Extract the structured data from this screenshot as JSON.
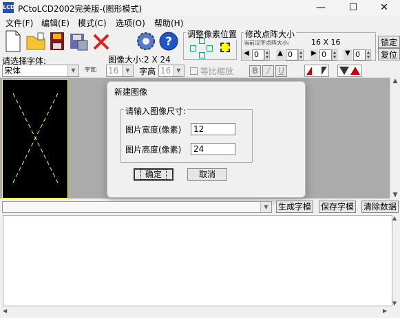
{
  "window": {
    "title": "PCtoLCD2002完美版-(图形模式)",
    "minimize": "—",
    "maximize": "☐",
    "close": "✕"
  },
  "menu": [
    {
      "label": "文件(F)"
    },
    {
      "label": "编辑(E)"
    },
    {
      "label": "模式(C)"
    },
    {
      "label": "选项(O)"
    },
    {
      "label": "帮助(H)"
    }
  ],
  "toolbar": {
    "new_icon": "new-file-icon",
    "open_icon": "open-folder-icon",
    "save_icon": "save-icon",
    "export_icon": "save-as-icon",
    "delete_icon": "delete-x-icon",
    "settings_icon": "gear-icon",
    "help_icon": "help-icon"
  },
  "pixel_adjust": {
    "label": "调整像素位置"
  },
  "dot_size": {
    "label": "修改点阵大小",
    "current_label": "当前汉字点阵大小:",
    "current_value": "16 X 16",
    "spin_values": [
      "0",
      "0",
      "0",
      "0"
    ]
  },
  "side_buttons": {
    "lock": "锁定",
    "reset": "复位"
  },
  "font": {
    "prompt": "请选择字体:",
    "selected": "宋体",
    "size_label": "字宽:",
    "size_value": "16"
  },
  "image": {
    "size_label": "图像大小:",
    "size_value": "2 X 24",
    "height_label": "字高",
    "height_value": "16",
    "proportional": "等比缩放"
  },
  "style_buttons": [
    "B",
    "/",
    "U"
  ],
  "dialog": {
    "title": "新建图像",
    "group": "请输入图像尺寸:",
    "width_label": "图片宽度(像素)",
    "width_value": "12",
    "height_label": "图片高度(像素)",
    "height_value": "24",
    "ok": "确定",
    "cancel": "取消"
  },
  "actions": {
    "generate": "生成字模",
    "save": "保存字模",
    "clear": "清除数据"
  },
  "colors": {
    "glyph_line": "#ffff40",
    "canvas_bg": "#000000",
    "canvas_frame": "#ababab"
  }
}
